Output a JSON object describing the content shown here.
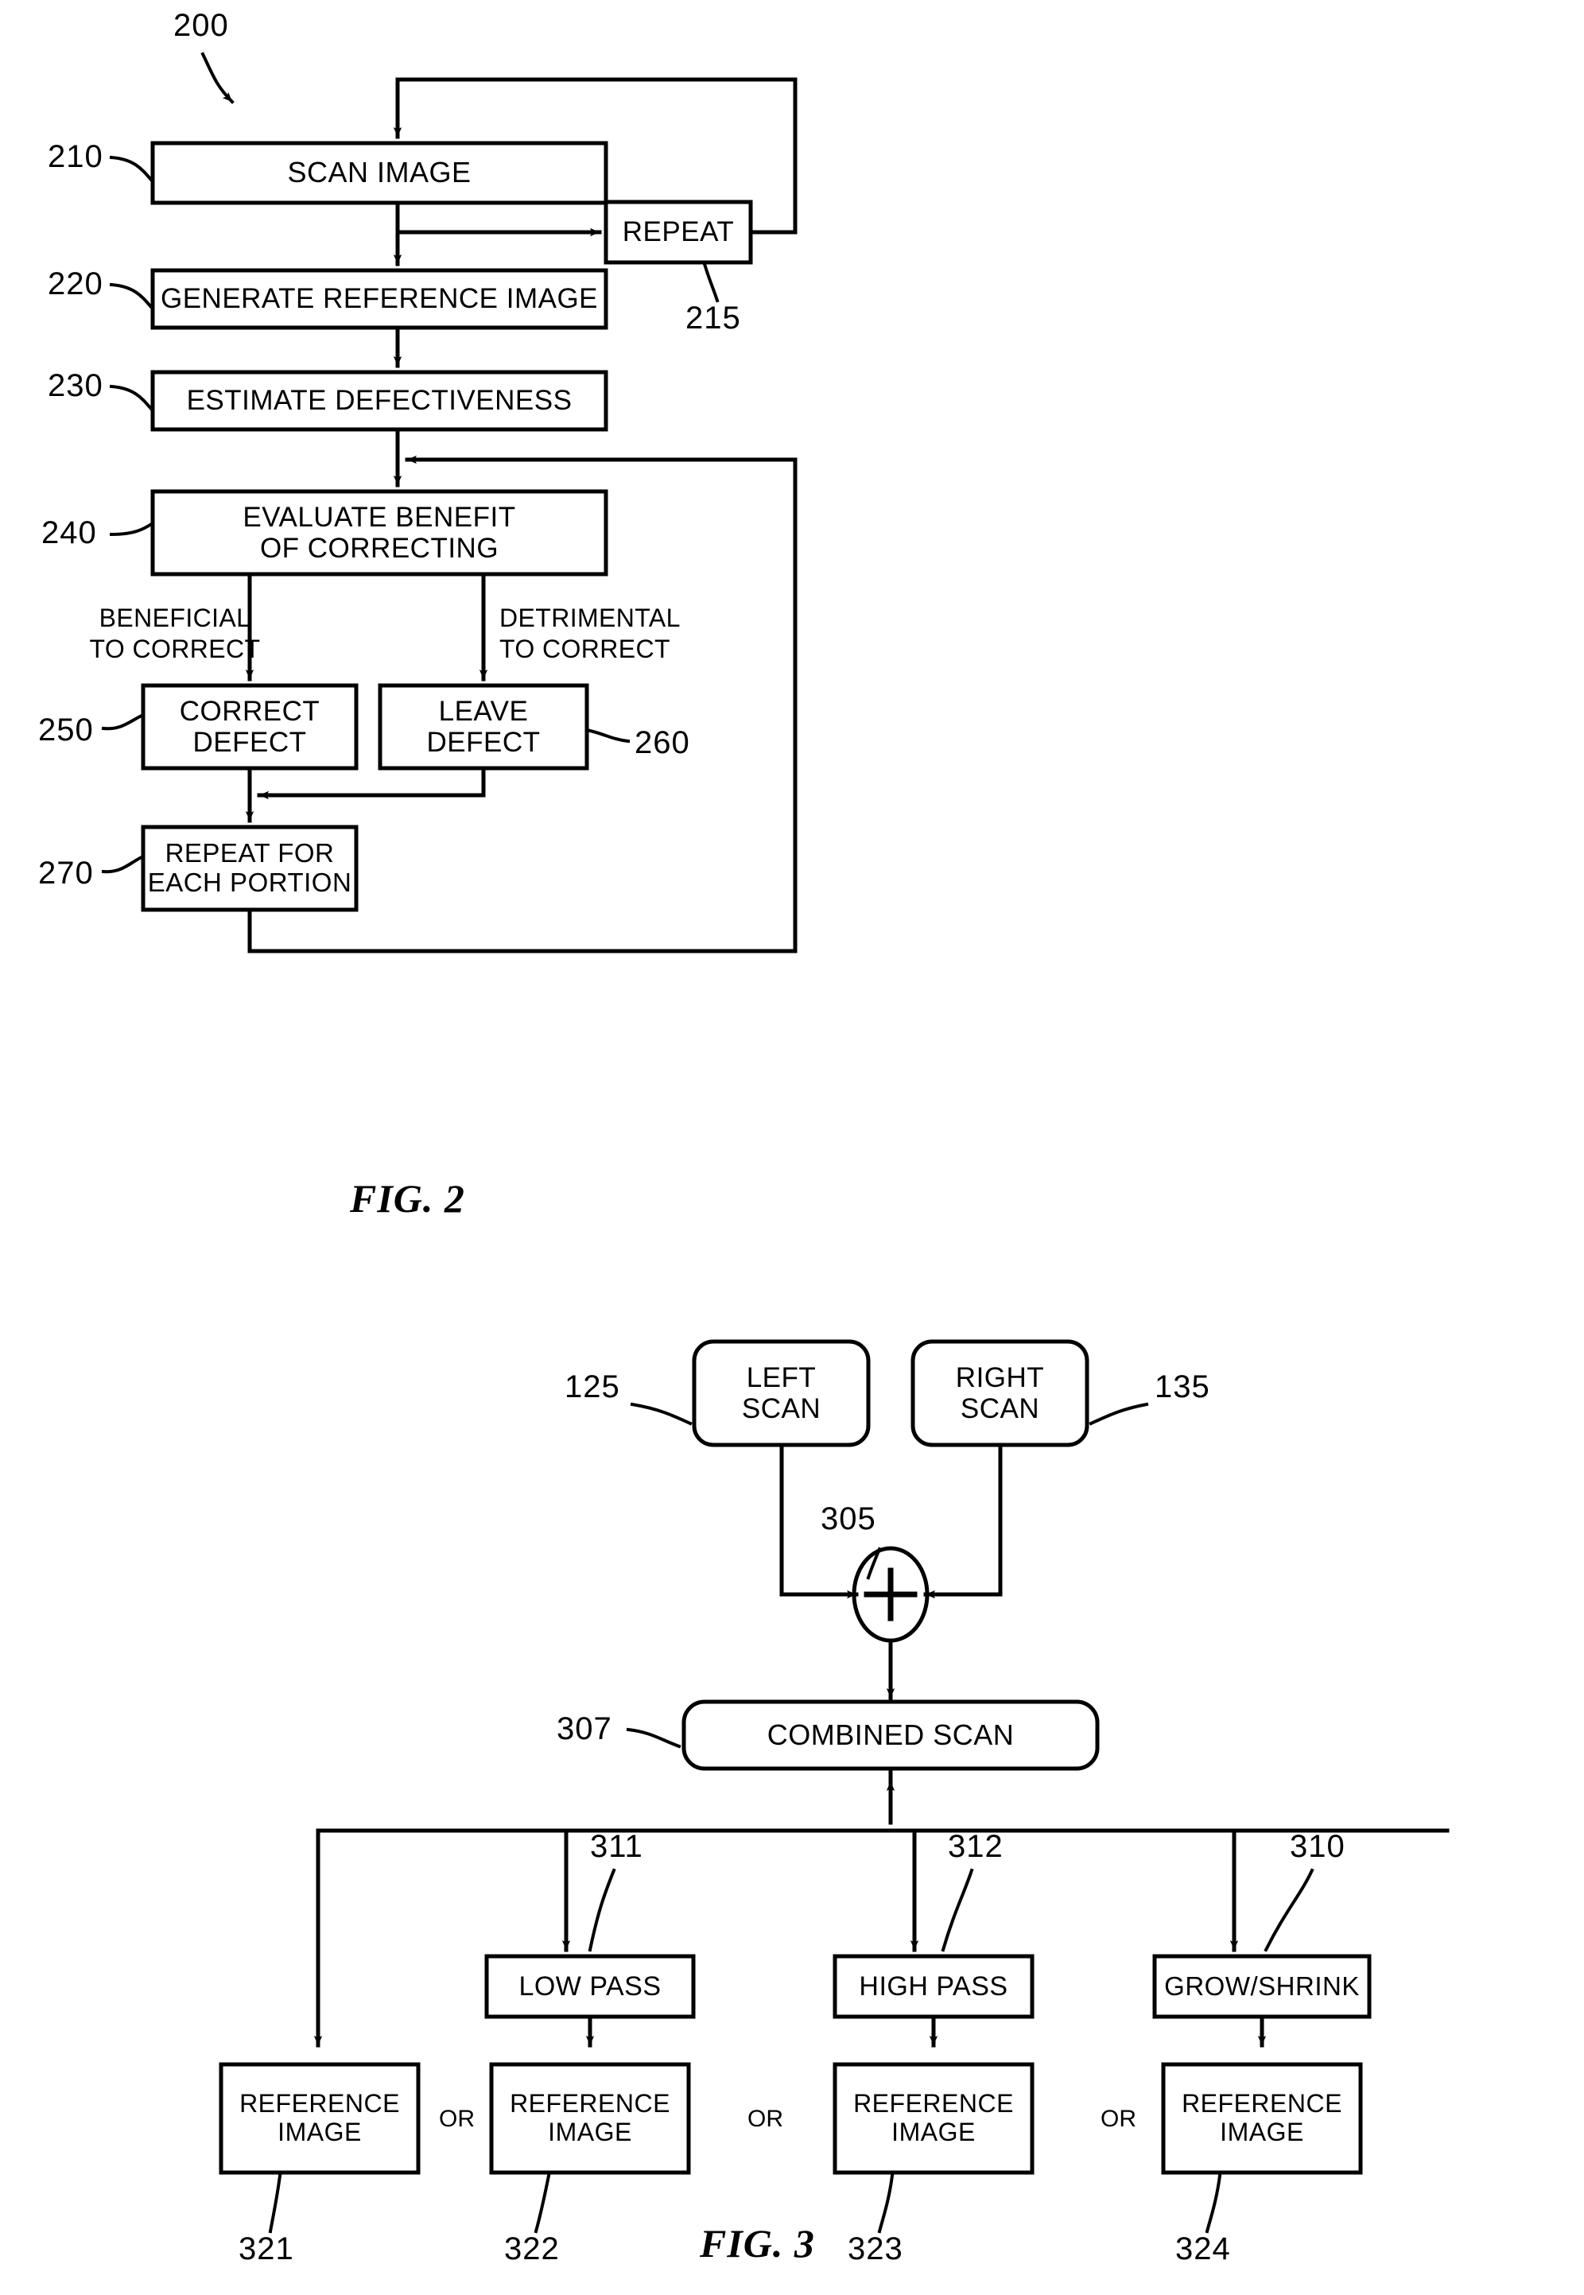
{
  "document": {
    "type": "patent-drawing-sheet",
    "figures": [
      "FIG. 2",
      "FIG. 3"
    ]
  },
  "fig2": {
    "caption": "FIG. 2",
    "diagram_tag": "200",
    "nodes": [
      {
        "id": "n210",
        "ref": "210",
        "label": "SCAN IMAGE"
      },
      {
        "id": "n215",
        "ref": "215",
        "label": "REPEAT"
      },
      {
        "id": "n220",
        "ref": "220",
        "label": "GENERATE REFERENCE IMAGE"
      },
      {
        "id": "n230",
        "ref": "230",
        "label": "ESTIMATE DEFECTIVENESS"
      },
      {
        "id": "n240",
        "ref": "240",
        "label": "EVALUATE BENEFIT\nOF CORRECTING"
      },
      {
        "id": "n250",
        "ref": "250",
        "label": "CORRECT\nDEFECT"
      },
      {
        "id": "n260",
        "ref": "260",
        "label": "LEAVE\nDEFECT"
      },
      {
        "id": "n270",
        "ref": "270",
        "label": "REPEAT FOR\nEACH PORTION"
      }
    ],
    "edge_labels": [
      {
        "id": "e_benef",
        "text": "BENEFICIAL\nTO CORRECT"
      },
      {
        "id": "e_detri",
        "text": "DETRIMENTAL\nTO CORRECT"
      }
    ]
  },
  "fig3": {
    "caption": "FIG. 3",
    "nodes": [
      {
        "id": "m125",
        "ref": "125",
        "label": "LEFT\nSCAN"
      },
      {
        "id": "m135",
        "ref": "135",
        "label": "RIGHT\nSCAN"
      },
      {
        "id": "m305",
        "ref": "305",
        "label": "+"
      },
      {
        "id": "m307",
        "ref": "307",
        "label": "COMBINED SCAN"
      },
      {
        "id": "m311",
        "ref": "311",
        "label": "LOW PASS"
      },
      {
        "id": "m312",
        "ref": "312",
        "label": "HIGH PASS"
      },
      {
        "id": "m310",
        "ref": "310",
        "label": "GROW/SHRINK"
      },
      {
        "id": "m321",
        "ref": "321",
        "label": "REFERENCE\nIMAGE"
      },
      {
        "id": "m322",
        "ref": "322",
        "label": "REFERENCE\nIMAGE"
      },
      {
        "id": "m323",
        "ref": "323",
        "label": "REFERENCE\nIMAGE"
      },
      {
        "id": "m324",
        "ref": "324",
        "label": "REFERENCE\nIMAGE"
      }
    ],
    "separators": [
      "OR",
      "OR",
      "OR"
    ]
  },
  "colors": {
    "ink": "#000000",
    "paper": "#ffffff"
  }
}
